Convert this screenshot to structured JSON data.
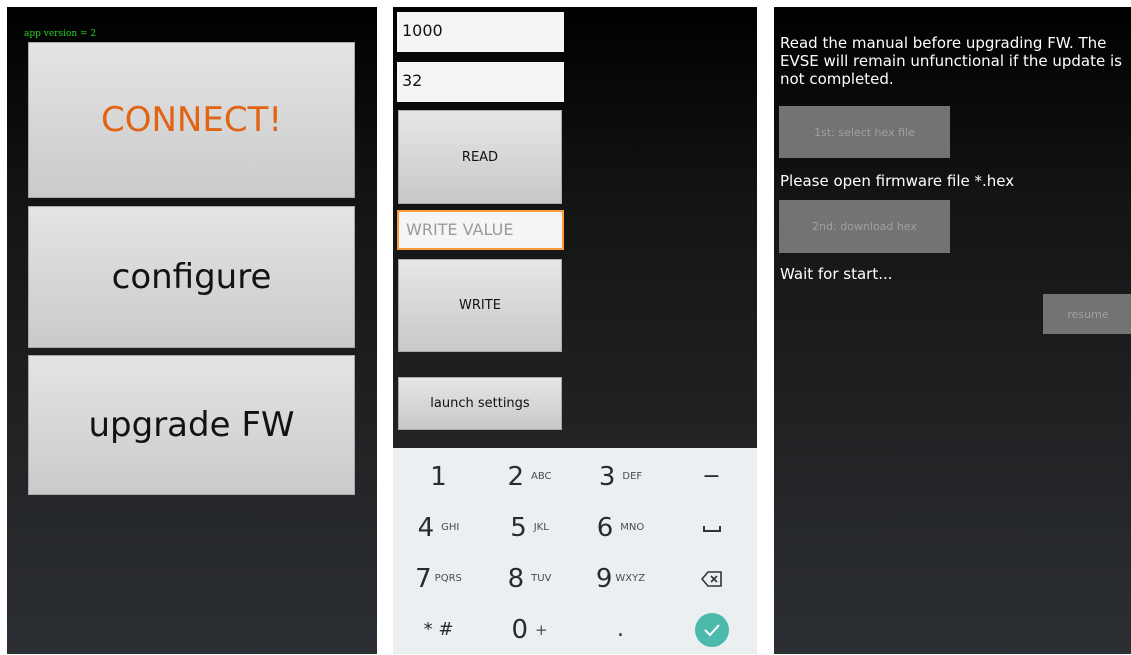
{
  "screen1": {
    "app_version": "app version = 2",
    "connect_label": "CONNECT!",
    "configure_label": "configure",
    "upgrade_label": "upgrade FW",
    "connect_color": "#E06414",
    "version_color": "#27D227"
  },
  "screen2": {
    "field1_value": "1000",
    "field2_value": "32",
    "write_field_placeholder": "WRITE VALUE",
    "read_label": "READ",
    "write_label": "WRITE",
    "launch_settings_label": "launch settings",
    "keypad": {
      "keys": [
        {
          "digit": "1",
          "letters": ""
        },
        {
          "digit": "2",
          "letters": "ABC"
        },
        {
          "digit": "3",
          "letters": "DEF"
        },
        {
          "digit": "4",
          "letters": "GHI"
        },
        {
          "digit": "5",
          "letters": "JKL"
        },
        {
          "digit": "6",
          "letters": "MNO"
        },
        {
          "digit": "7",
          "letters": "PQRS"
        },
        {
          "digit": "8",
          "letters": "TUV"
        },
        {
          "digit": "9",
          "letters": "WXYZ"
        },
        {
          "digit": "* #",
          "letters": ""
        },
        {
          "digit": "0",
          "letters": "+"
        },
        {
          "digit": ".",
          "letters": ""
        }
      ],
      "minus": "−",
      "space_icon": "space-bar-icon",
      "backspace_icon": "backspace-icon",
      "done_icon": "check-icon",
      "done_color": "#4CB9AD"
    }
  },
  "screen3": {
    "warning": "Read the manual before upgrading FW. The EVSE will remain unfunctional if the update is not completed.",
    "select_hex_label": "1st: select hex file",
    "open_firmware_msg": "Please open firmware file *.hex",
    "download_hex_label": "2nd: download hex",
    "wait_msg": "Wait for start...",
    "resume_label": "resume"
  }
}
